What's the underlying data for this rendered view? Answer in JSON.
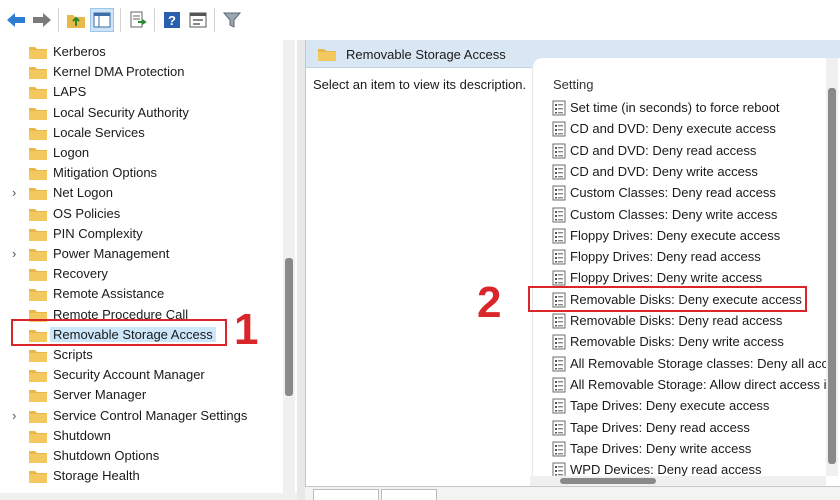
{
  "toolbar": {
    "buttons": [
      "back-icon",
      "forward-icon",
      "up-folder-icon",
      "show-hide-tree-icon",
      "export-list-icon",
      "help-icon",
      "properties-icon",
      "filter-icon"
    ]
  },
  "tree": {
    "items": [
      {
        "label": "Kerberos",
        "expandable": false
      },
      {
        "label": "Kernel DMA Protection",
        "expandable": false
      },
      {
        "label": "LAPS",
        "expandable": false
      },
      {
        "label": "Local Security Authority",
        "expandable": false
      },
      {
        "label": "Locale Services",
        "expandable": false
      },
      {
        "label": "Logon",
        "expandable": false
      },
      {
        "label": "Mitigation Options",
        "expandable": false
      },
      {
        "label": "Net Logon",
        "expandable": true
      },
      {
        "label": "OS Policies",
        "expandable": false
      },
      {
        "label": "PIN Complexity",
        "expandable": false
      },
      {
        "label": "Power Management",
        "expandable": true
      },
      {
        "label": "Recovery",
        "expandable": false
      },
      {
        "label": "Remote Assistance",
        "expandable": false
      },
      {
        "label": "Remote Procedure Call",
        "expandable": false
      },
      {
        "label": "Removable Storage Access",
        "expandable": false,
        "selected": true
      },
      {
        "label": "Scripts",
        "expandable": false
      },
      {
        "label": "Security Account Manager",
        "expandable": false
      },
      {
        "label": "Server Manager",
        "expandable": false
      },
      {
        "label": "Service Control Manager Settings",
        "expandable": true
      },
      {
        "label": "Shutdown",
        "expandable": false
      },
      {
        "label": "Shutdown Options",
        "expandable": false
      },
      {
        "label": "Storage Health",
        "expandable": false
      }
    ]
  },
  "details": {
    "header_title": "Removable Storage Access",
    "description": "Select an item to view its description.",
    "column_header": "Setting",
    "settings": [
      "Set time (in seconds) to force reboot",
      "CD and DVD: Deny execute access",
      "CD and DVD: Deny read access",
      "CD and DVD: Deny write access",
      "Custom Classes: Deny read access",
      "Custom Classes: Deny write access",
      "Floppy Drives: Deny execute access",
      "Floppy Drives: Deny read access",
      "Floppy Drives: Deny write access",
      "Removable Disks: Deny execute access",
      "Removable Disks: Deny read access",
      "Removable Disks: Deny write access",
      "All Removable Storage classes: Deny all acce",
      "All Removable Storage: Allow direct access ir",
      "Tape Drives: Deny execute access",
      "Tape Drives: Deny read access",
      "Tape Drives: Deny write access",
      "WPD Devices: Deny read access"
    ]
  },
  "annotations": {
    "step1": "1",
    "step2": "2",
    "color": "#d9262b"
  },
  "colors": {
    "header_bg": "#d9e7f5",
    "selection_bg": "#cce6fa",
    "folder": "#e8b84a"
  }
}
